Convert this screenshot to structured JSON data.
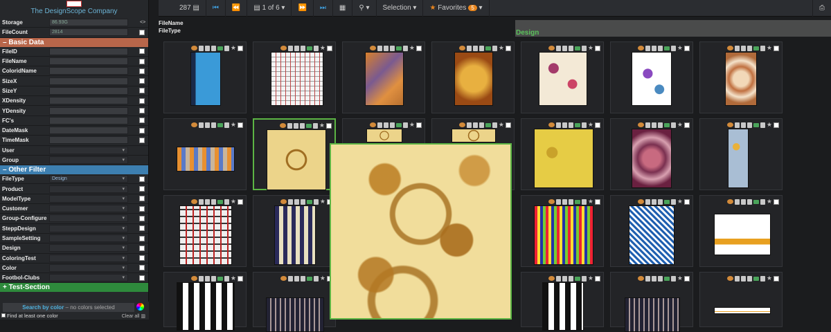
{
  "company": "The DesignScope Company",
  "storage": {
    "label": "Storage",
    "value": "86.93G"
  },
  "filecount": {
    "label": "FileCount",
    "value": "2814"
  },
  "basic_section": "– Basic Data",
  "basic_fields": [
    "FileID",
    "FileName",
    "ColoridName",
    "SizeX",
    "SizeY",
    "XDensity",
    "YDensity",
    "FC's",
    "DateMask",
    "TimeMask"
  ],
  "basic_dropdowns": [
    "User",
    "Group"
  ],
  "other_section": "– Other Filter",
  "other_filters": [
    {
      "label": "FileType",
      "value": "Design"
    },
    {
      "label": "Product",
      "value": ""
    },
    {
      "label": "ModelType",
      "value": ""
    },
    {
      "label": "Customer",
      "value": ""
    },
    {
      "label": "Group-Configure",
      "value": ""
    },
    {
      "label": "SteppDesign",
      "value": ""
    },
    {
      "label": "SampleSetting",
      "value": ""
    },
    {
      "label": "Design",
      "value": ""
    },
    {
      "label": "ColoringTest",
      "value": ""
    },
    {
      "label": "Color",
      "value": ""
    },
    {
      "label": "Footbol-Clubs",
      "value": ""
    }
  ],
  "test_section": "+ Test-Section",
  "color_search": {
    "title": "Search by color",
    "status": "– no colors selected",
    "hint": "Find at least one color",
    "clear": "Clear all"
  },
  "toolbar": {
    "count": "287",
    "page": "1 of 6",
    "selection": "Selection",
    "favorites": "Favorites",
    "fav_count": "5"
  },
  "info": {
    "filename": "FileName",
    "filetype": "FileType",
    "type_value": "Design"
  },
  "icons": {
    "first": "first-page-icon",
    "prev": "prev-page-icon",
    "next": "next-page-icon",
    "last": "last-page-icon",
    "grid": "grid-icon",
    "search": "search-icon",
    "print": "print-icon"
  }
}
